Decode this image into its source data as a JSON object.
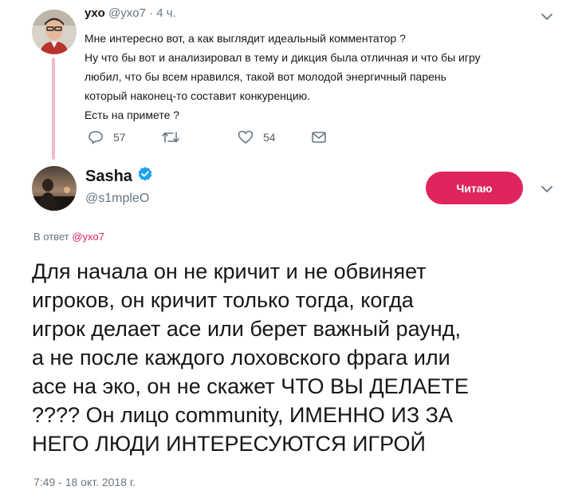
{
  "colors": {
    "accent": "#e0245e",
    "text": "#14171a",
    "muted": "#657786",
    "thread_line": "#f5b8cb",
    "verified": "#1da1f2"
  },
  "parent_tweet": {
    "name": "yxo",
    "handle": "@yxo7",
    "time": "· 4 ч.",
    "lines": [
      "Мне интересно вот, а как выглядит идеальный комментатор ?",
      "Ну что бы вот и анализировал в тему и дикция была отличная и что бы игру",
      "любил, что бы всем нравился, такой вот молодой энергичный парень",
      "который наконец-то составит конкуренцию.",
      "Есть на примете ?"
    ],
    "actions": {
      "reply_count": "57",
      "retweet_count": "",
      "like_count": "54"
    }
  },
  "main_tweet": {
    "name": "Sasha",
    "handle": "@s1mpleO",
    "follow_label": "Читаю",
    "reply_prefix": "В ответ",
    "reply_handle": "@yxo7",
    "lines": [
      "Для начала он не кричит и не обвиняет",
      "игроков, он кричит только тогда, когда",
      "игрок делает асе или берет важный раунд,",
      "а не после каждого лоховского фрага или",
      "асе на эко, он не скажет ЧТО ВЫ ДЕЛАЕТЕ",
      "???? Он лицо community, ИМЕННО ИЗ ЗА",
      "НЕГО ЛЮДИ ИНТЕРЕСУЮТСЯ ИГРОЙ"
    ],
    "timestamp": "7:49 - 18 окт. 2018 г."
  },
  "icons": {
    "reply": "reply-icon",
    "retweet": "retweet-icon",
    "like": "heart-icon",
    "dm": "envelope-icon",
    "menu": "chevron-down-icon",
    "verified": "verified-badge-icon"
  }
}
